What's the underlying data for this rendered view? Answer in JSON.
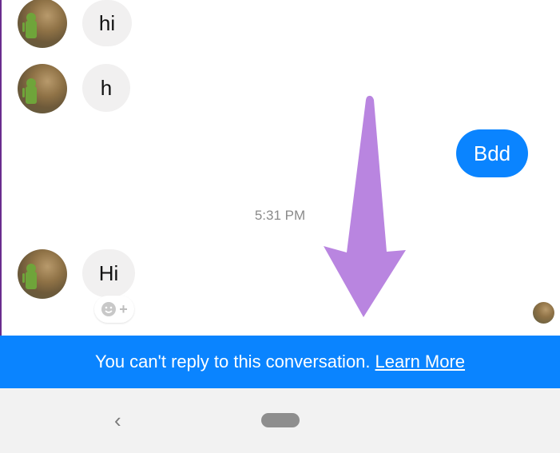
{
  "messages": [
    {
      "text": "hi"
    },
    {
      "text": "h"
    },
    {
      "text": "Bdd"
    },
    {
      "text": "Hi"
    }
  ],
  "timestamp": "5:31 PM",
  "banner": {
    "text": "You can't reply to this conversation.",
    "link": "Learn More"
  },
  "reaction": {
    "plus": "+"
  },
  "nav": {
    "back": "‹"
  },
  "colors": {
    "accent": "#0a84ff",
    "incoming_bubble": "#f1f0f0",
    "arrow": "#b985e0"
  },
  "icons": [
    "avatar",
    "smiley-add-icon",
    "down-arrow-annotation",
    "back-icon",
    "home-pill"
  ]
}
